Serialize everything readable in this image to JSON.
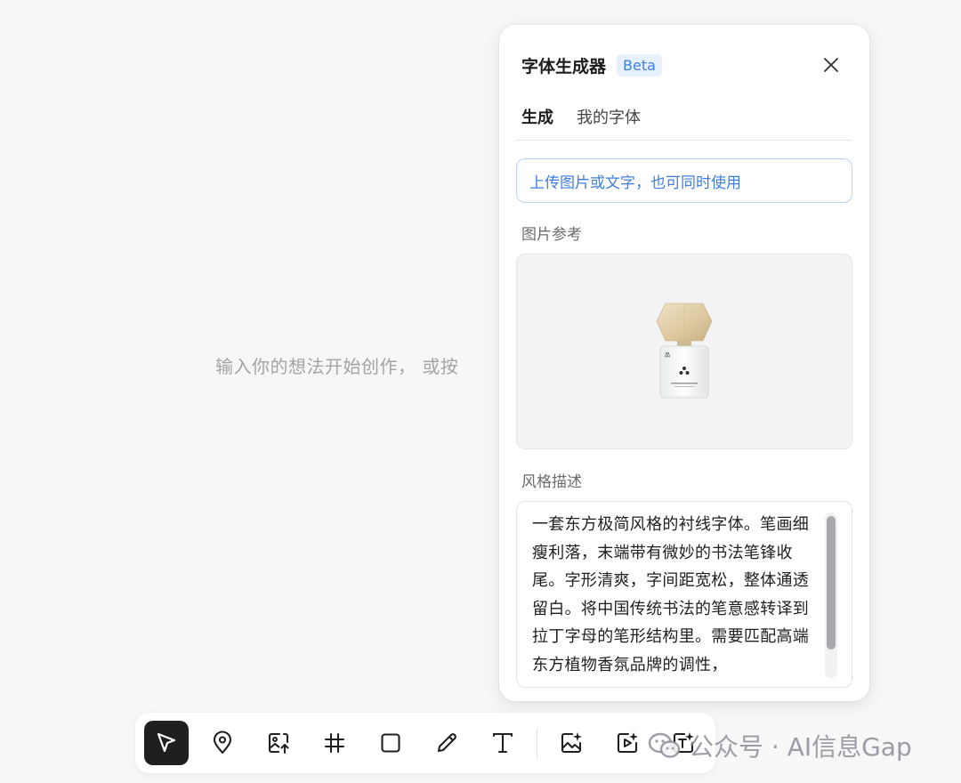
{
  "canvas": {
    "hint": "输入你的想法开始创作， 或按"
  },
  "panel": {
    "title": "字体生成器",
    "badge": "Beta",
    "tabs": [
      {
        "label": "生成",
        "active": true
      },
      {
        "label": "我的字体",
        "active": false
      }
    ],
    "upload_label": "上传图片或文字，也可同时使用",
    "image_section_label": "图片参考",
    "style_section_label": "风格描述",
    "style_text": "一套东方极简风格的衬线字体。笔画细瘦利落，末端带有微妙的书法笔锋收尾。字形清爽，字间距宽松，整体通透留白。将中国传统书法的笔意感转译到拉丁字母的笔形结构里。需要匹配高端东方植物香氛品牌的调性，"
  },
  "toolbar": {
    "tools": [
      {
        "name": "select-tool",
        "icon": "cursor-arrow-icon",
        "active": true
      },
      {
        "name": "pin-tool",
        "icon": "map-pin-icon"
      },
      {
        "name": "image-upload-tool",
        "icon": "image-upload-icon"
      },
      {
        "name": "frame-tool",
        "icon": "hash-frame-icon"
      },
      {
        "name": "rectangle-tool",
        "icon": "square-icon"
      },
      {
        "name": "pen-tool",
        "icon": "pencil-icon"
      },
      {
        "name": "text-tool",
        "icon": "text-t-icon"
      },
      {
        "name": "ai-image-tool",
        "icon": "image-sparkle-icon"
      },
      {
        "name": "ai-video-tool",
        "icon": "video-sparkle-icon"
      },
      {
        "name": "ai-font-tool",
        "icon": "text-sparkle-icon"
      }
    ]
  },
  "watermark": {
    "text": "公众号 · AI信息Gap"
  },
  "colors": {
    "accent": "#3f7fe0",
    "badge_bg": "#e7f0fd",
    "active_tool_bg": "#1f1f1f"
  }
}
